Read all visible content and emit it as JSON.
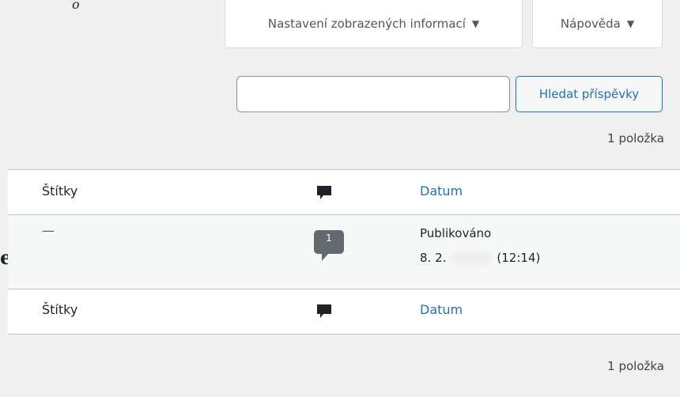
{
  "fragments": {
    "top": "o",
    "side": "e"
  },
  "screen_tabs": {
    "screen_options": "Nastavení zobrazených informací",
    "help": "Nápověda",
    "arrow": "▼"
  },
  "search": {
    "value": "",
    "button": "Hledat příspěvky"
  },
  "count_top": "1 položka",
  "count_bottom": "1 položka",
  "table": {
    "header": {
      "tags": "Štítky",
      "date": "Datum"
    },
    "footer": {
      "tags": "Štítky",
      "date": "Datum"
    },
    "row": {
      "tags": "—",
      "comments": "1",
      "status": "Publikováno",
      "date_prefix": "8. 2.",
      "time": "(12:14)"
    }
  },
  "colors": {
    "accent": "#2271b1",
    "bubble": "#646970",
    "icon": "#1d2327"
  }
}
